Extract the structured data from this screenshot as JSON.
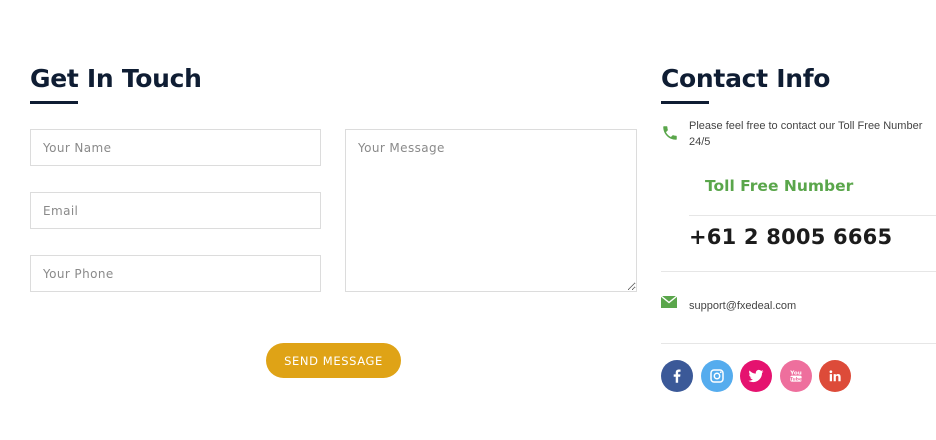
{
  "form": {
    "heading": "Get In Touch",
    "name_placeholder": "Your Name",
    "email_placeholder": "Email",
    "phone_placeholder": "Your Phone",
    "message_placeholder": "Your Message",
    "submit_label": "SEND MESSAGE"
  },
  "contact": {
    "heading": "Contact Info",
    "intro_text": "Please feel free to contact our Toll Free Number 24/5",
    "toll_free_label": "Toll Free Number",
    "toll_free_number": "+61 2 8005 6665",
    "email": "support@fxedeal.com"
  },
  "social": [
    "facebook-icon",
    "instagram-icon",
    "twitter-icon",
    "youtube-icon",
    "linkedin-icon"
  ],
  "colors": {
    "heading": "#0f1d33",
    "accent_green": "#5aa64b",
    "button": "#dfa316",
    "facebook": "#3b5998",
    "instagram": "#55acee",
    "twitter": "#e5126f",
    "youtube": "#ee6f9d",
    "linkedin": "#dd4b39"
  }
}
